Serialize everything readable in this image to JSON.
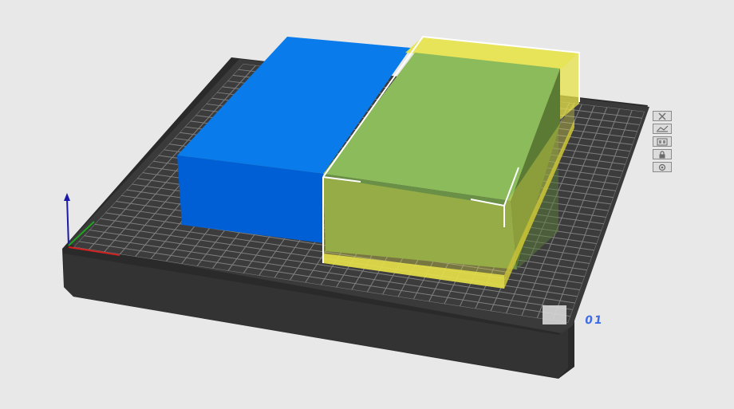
{
  "plate": {
    "label": "01",
    "label_color": "#3f6de6",
    "base_color": "#383838",
    "grid_color": "#8c8c8c"
  },
  "objects": [
    {
      "name": "blue-box",
      "color": "#0073e6",
      "selected": false
    },
    {
      "name": "green-box",
      "color": "#8ab95c",
      "selected": true,
      "bbox_color": "#e8e34a"
    }
  ],
  "axes": {
    "x_color": "#d22020",
    "y_color": "#1fa31f",
    "z_color": "#1a1aa8"
  },
  "plate_toolbar": [
    {
      "icon": "close-icon"
    },
    {
      "icon": "auto-orient-icon"
    },
    {
      "icon": "arrange-icon"
    },
    {
      "icon": "lock-icon"
    },
    {
      "icon": "settings-icon"
    }
  ]
}
